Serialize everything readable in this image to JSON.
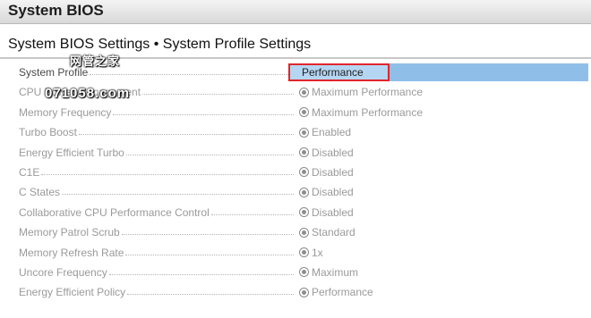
{
  "window": {
    "title": "System BIOS"
  },
  "page": {
    "heading": "System BIOS Settings • System Profile Settings"
  },
  "system_profile": {
    "label": "System Profile",
    "value": "Performance"
  },
  "settings": [
    {
      "label": "CPU Power Management",
      "value": "Maximum Performance"
    },
    {
      "label": "Memory Frequency",
      "value": "Maximum Performance"
    },
    {
      "label": "Turbo Boost",
      "value": "Enabled"
    },
    {
      "label": "Energy Efficient Turbo",
      "value": "Disabled"
    },
    {
      "label": "C1E",
      "value": "Disabled"
    },
    {
      "label": "C States",
      "value": "Disabled"
    },
    {
      "label": "Collaborative CPU Performance Control",
      "value": "Disabled"
    },
    {
      "label": "Memory Patrol Scrub",
      "value": "Standard"
    },
    {
      "label": "Memory Refresh Rate",
      "value": "1x"
    },
    {
      "label": "Uncore Frequency",
      "value": "Maximum"
    },
    {
      "label": "Energy Efficient Policy",
      "value": "Performance"
    }
  ],
  "watermark": {
    "line1": "网管之家",
    "line2": "071058.com"
  },
  "colors": {
    "selection": "#8fbfe8",
    "highlight_border": "#e0262a"
  }
}
